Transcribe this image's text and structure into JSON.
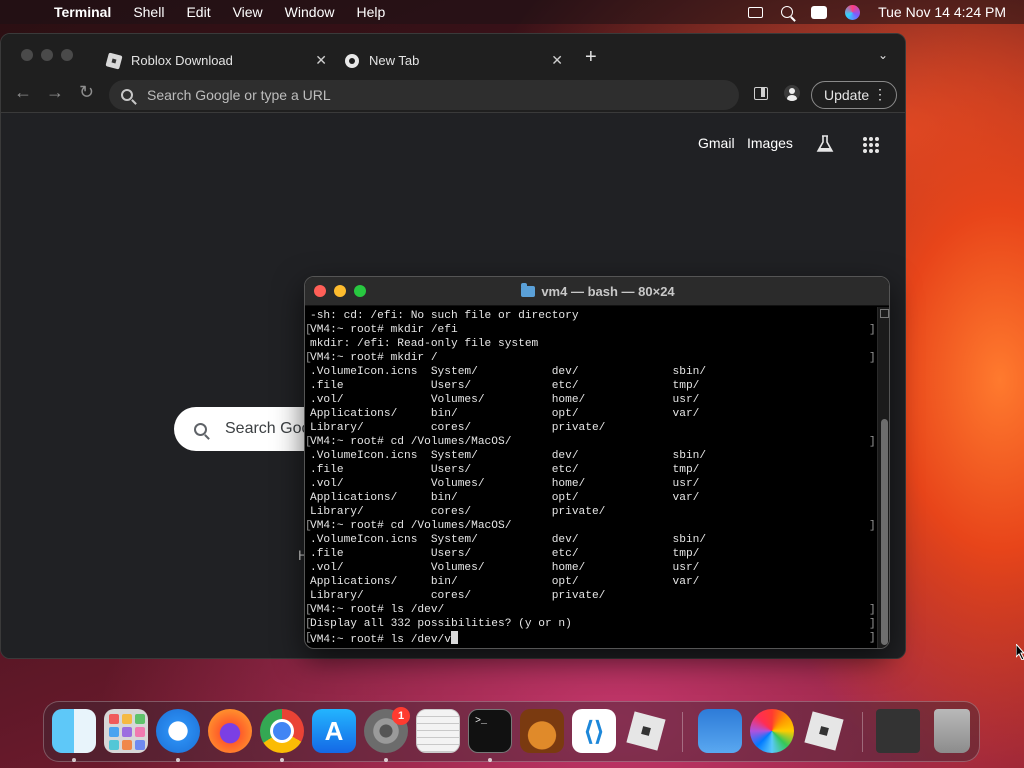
{
  "menubar": {
    "app_name": "Terminal",
    "items": [
      "Shell",
      "Edit",
      "View",
      "Window",
      "Help"
    ],
    "clock": "Tue Nov 14  4:24 PM"
  },
  "browser": {
    "tabs": [
      {
        "label": "Roblox Download",
        "icon": "roblox-icon"
      },
      {
        "label": "New Tab",
        "icon": "chrome-icon"
      }
    ],
    "omnibox_placeholder": "Search Google or type a URL",
    "update_label": "Update",
    "links": {
      "gmail": "Gmail",
      "images": "Images"
    },
    "search_box_text": "Search Goo",
    "ghost_text": "H"
  },
  "terminal": {
    "title": "vm4 — bash — 80×24",
    "lines": [
      "-sh: cd: /efi: No such file or directory",
      "VM4:~ root# mkdir /efi",
      "mkdir: /efi: Read-only file system",
      "VM4:~ root# mkdir /",
      ".VolumeIcon.icns  System/           dev/              sbin/",
      ".file             Users/            etc/              tmp/",
      ".vol/             Volumes/          home/             usr/",
      "Applications/     bin/              opt/              var/",
      "Library/          cores/            private/",
      "VM4:~ root# cd /Volumes/MacOS/",
      ".VolumeIcon.icns  System/           dev/              sbin/",
      ".file             Users/            etc/              tmp/",
      ".vol/             Volumes/          home/             usr/",
      "Applications/     bin/              opt/              var/",
      "Library/          cores/            private/",
      "VM4:~ root# cd /Volumes/MacOS/",
      ".VolumeIcon.icns  System/           dev/              sbin/",
      ".file             Users/            etc/              tmp/",
      ".vol/             Volumes/          home/             usr/",
      "Applications/     bin/              opt/              var/",
      "Library/          cores/            private/",
      "VM4:~ root# ls /dev/",
      "Display all 332 possibilities? (y or n)",
      "VM4:~ root# ls /dev/v"
    ]
  },
  "dock": {
    "items": [
      "Finder",
      "Launchpad",
      "Safari",
      "Firefox",
      "Google Chrome",
      "App Store",
      "System Settings",
      "TextEdit",
      "Terminal",
      "GarageBand",
      "Visual Studio Code",
      "Roblox",
      "Weather",
      "Photos",
      "Roblox Player",
      "Recent",
      "Trash"
    ],
    "settings_badge": "1",
    "terminal_glyph": ">_"
  }
}
